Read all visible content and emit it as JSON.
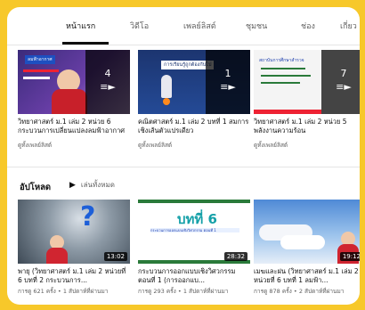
{
  "tabs": [
    {
      "label": "หน้าแรก",
      "active": true
    },
    {
      "label": "วิดีโอ"
    },
    {
      "label": "เพลย์ลิสต์"
    },
    {
      "label": "ชุมชน"
    },
    {
      "label": "ช่อง"
    },
    {
      "label": "เกี่ยว"
    }
  ],
  "playlists": [
    {
      "title": "วิทยาศาสตร์ ม.1 เล่ม 2 หน่วย 6 กระบวนการเปลี่ยนแปลงลมฟ้าอากาศ",
      "count": "4",
      "link": "ดูทั้งเพลย์ลิสต์",
      "thumb_title": "ลมฟ้าอากาศ"
    },
    {
      "title": "คณิตศาสตร์ ม.1 เล่ม 2 บทที่ 1 สมการเชิงเส้นตัวแปรเดียว",
      "count": "1",
      "link": "ดูทั้งเพลย์ลิสต์",
      "thumb_title": "การเรียนรู้ถูกต้องกับไป"
    },
    {
      "title": "วิทยาศาสตร์ ม.1 เล่ม 2 หน่วย 5 พลังงานความร้อน",
      "count": "7",
      "link": "ดูทั้งเพลย์ลิสต์",
      "thumb_title": "สถาบันการศึกษาสำรวจ"
    }
  ],
  "uploads": {
    "title": "อัปโหลด",
    "play_all": "เล่นทั้งหมด",
    "videos": [
      {
        "title": "พายุ (วิทยาศาสตร์ ม.1 เล่ม 2 หน่วยที่ 6 บทที่ 2 กระบวนการ...",
        "meta": "การดู 621 ครั้ง • 1 สัปดาห์ที่ผ่านมา",
        "duration": "13:02"
      },
      {
        "title": "กระบวนการออกแบบเชิงวิศวกรรม ตอนที่ 1 (การออกแบ...",
        "meta": "การดู 293 ครั้ง • 1 สัปดาห์ที่ผ่านมา",
        "duration": "28:32",
        "thumb_big": "บทที่ 6",
        "thumb_sub": "กระบวนการออกแบบเชิงวิศวกรรม ตอนที่ 1"
      },
      {
        "title": "เมฆและฝน (วิทยาศาสตร์ ม.1 เล่ม 2 หน่วยที่ 6 บทที่ 1 ลมฟ้า...",
        "meta": "การดู 878 ครั้ง • 2 สัปดาห์ที่ผ่านมา",
        "duration": "19:12"
      }
    ]
  },
  "colors": {
    "accent": "#f7c82a",
    "text": "#0f0f0f",
    "muted": "#606060"
  }
}
